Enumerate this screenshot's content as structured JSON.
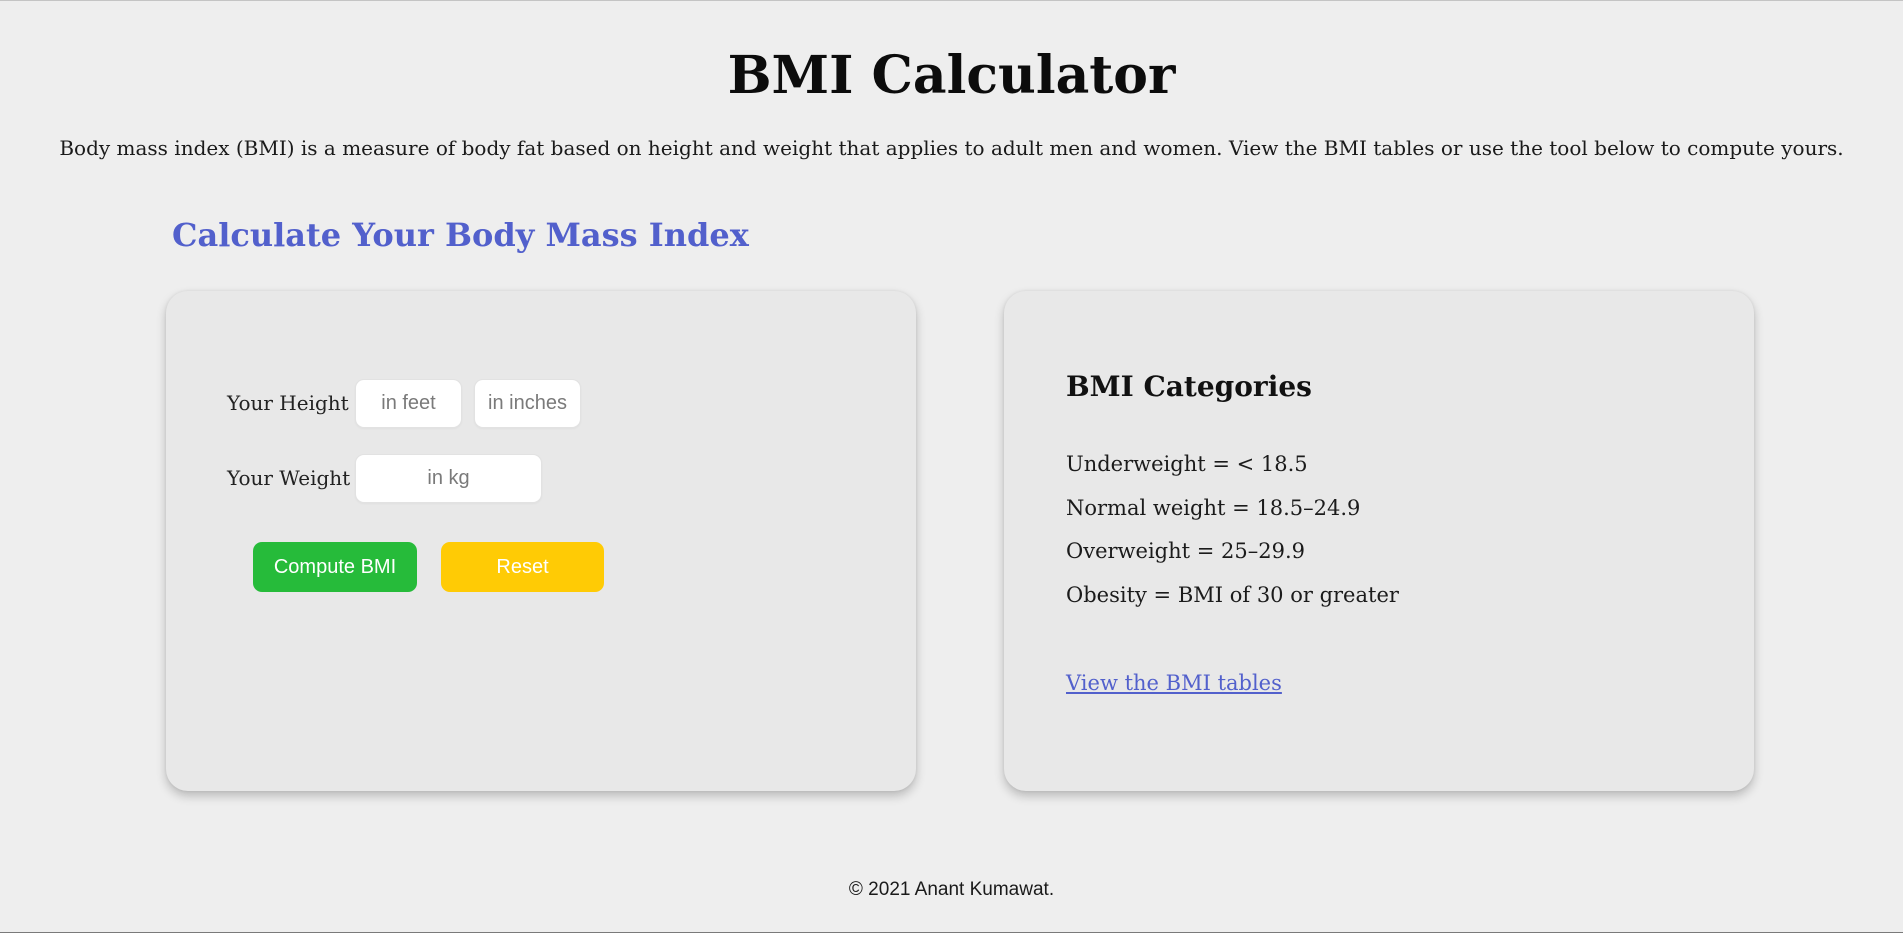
{
  "header": {
    "title": "BMI Calculator",
    "intro": "Body mass index (BMI) is a measure of body fat based on height and weight that applies to adult men and women. View the BMI tables or use the tool below to compute yours."
  },
  "calculator": {
    "heading": "Calculate Your Body Mass Index",
    "height_label": "Your Height",
    "height_feet_placeholder": "in feet",
    "height_inches_placeholder": "in inches",
    "weight_label": "Your Weight",
    "weight_placeholder": "in kg",
    "compute_label": "Compute BMI",
    "reset_label": "Reset",
    "colors": {
      "heading": "#5260cc",
      "compute_button": "#26bb3a",
      "reset_button": "#ffcb05"
    }
  },
  "categories": {
    "heading": "BMI Categories",
    "items": [
      "Underweight = < 18.5",
      "Normal weight = 18.5–24.9",
      "Overweight = 25–29.9",
      "Obesity = BMI of 30 or greater"
    ],
    "link_label": "View the BMI tables",
    "link_color": "#5260cc"
  },
  "footer": {
    "text": "© 2021 Anant Kumawat."
  }
}
